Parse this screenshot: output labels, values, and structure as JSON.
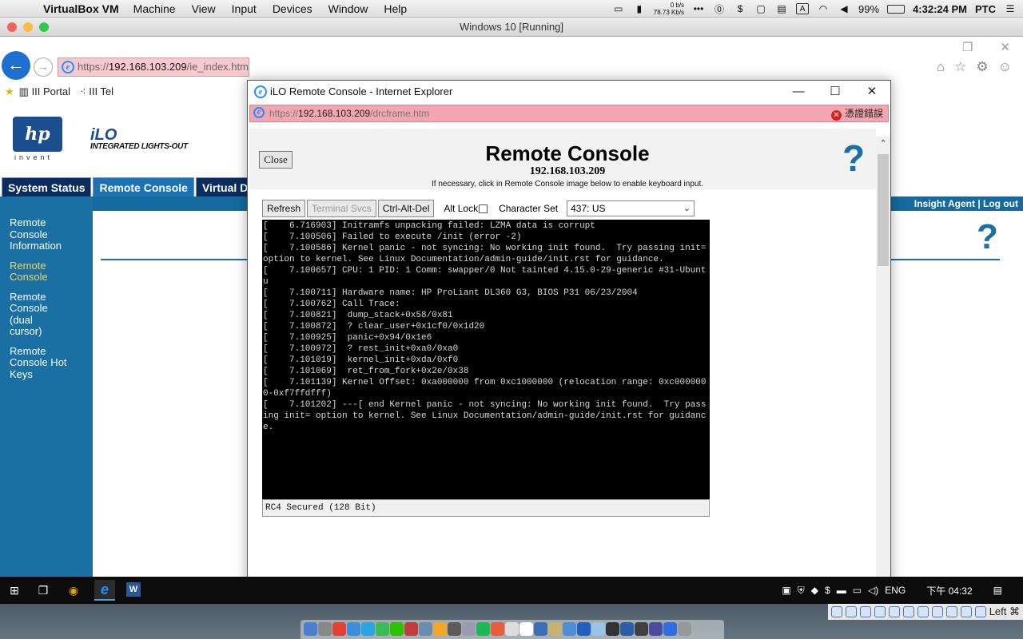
{
  "macbar": {
    "app": "VirtualBox VM",
    "menus": [
      "Machine",
      "View",
      "Input",
      "Devices",
      "Window",
      "Help"
    ],
    "net_up": "0 b/s",
    "net_down": "78.73 Kb/s",
    "ime_letter": "A",
    "battery": "99%",
    "clock": "4:32:24 PM",
    "timezone": "PTC"
  },
  "vbox": {
    "title": "Windows 10 [Running]"
  },
  "background_ie": {
    "address_host": "192.168.103.209",
    "address_rest": "/ie_index.htm",
    "favorites": [
      "III Portal",
      "III Tel"
    ]
  },
  "ilo": {
    "invent": "invent",
    "brand": "iLO",
    "brand_sub": "INTEGRATED LIGHTS-OUT",
    "tabs": [
      "System Status",
      "Remote Console",
      "Virtual Dev"
    ],
    "agent_links": "Insight Agent | Log out",
    "sidebar": [
      "Remote Console Information",
      "Remote Console",
      "Remote Console (dual cursor)",
      "Remote Console Hot Keys"
    ]
  },
  "popup": {
    "title": "iLO Remote Console - Internet Explorer",
    "address_prefix": "https://",
    "address_host": "192.168.103.209",
    "address_rest": "/drcframe.htm",
    "cert_error": "憑證錯誤",
    "close_label": "Close",
    "heading": "Remote Console",
    "ip": "192.168.103.209",
    "hint": "If necessary, click in Remote Console image below to enable keyboard input.",
    "toolbar": {
      "refresh": "Refresh",
      "terminal_svcs": "Terminal Svcs",
      "ctrl_alt_del": "Ctrl-Alt-Del",
      "alt_lock": "Alt Lock",
      "charset_label": "Character Set",
      "charset_value": "437: US"
    },
    "terminal_lines": [
      "[    6.716903] Initramfs unpacking failed: LZMA data is corrupt",
      "[    7.100506] Failed to execute /init (error -2)",
      "[    7.100586] Kernel panic - not syncing: No working init found.  Try passing init= option to kernel. See Linux Documentation/admin-guide/init.rst for guidance.",
      "[    7.100657] CPU: 1 PID: 1 Comm: swapper/0 Not tainted 4.15.0-29-generic #31-Ubuntu",
      "[    7.100711] Hardware name: HP ProLiant DL360 G3, BIOS P31 06/23/2004",
      "[    7.100762] Call Trace:",
      "[    7.100821]  dump_stack+0x58/0x81",
      "[    7.100872]  ? clear_user+0x1cf0/0x1d20",
      "[    7.100925]  panic+0x94/0x1e6",
      "[    7.100972]  ? rest_init+0xa0/0xa0",
      "[    7.101019]  kernel_init+0xda/0xf0",
      "[    7.101069]  ret_from_fork+0x2e/0x38",
      "[    7.101139] Kernel Offset: 0xa000000 from 0xc1000000 (relocation range: 0xc0000000-0xf7ffdfff)",
      "[    7.101202] ---[ end Kernel panic - not syncing: No working init found.  Try passing init= option to kernel. See Linux Documentation/admin-guide/init.rst for guidance."
    ],
    "status": "RC4 Secured (128 Bit)"
  },
  "taskbar": {
    "lang": "ENG",
    "clock": "下午 04:32"
  },
  "vbox_status": {
    "host_key": "Left ⌘"
  }
}
